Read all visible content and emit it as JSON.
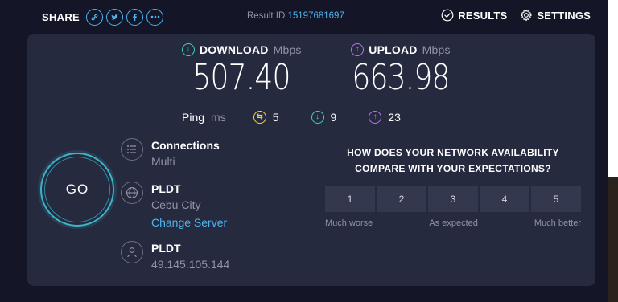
{
  "header": {
    "share_label": "SHARE",
    "share_icons": [
      "link-icon",
      "twitter-icon",
      "facebook-icon",
      "more-icon"
    ],
    "result_id_label": "Result ID",
    "result_id_value": "15197681697",
    "results_label": "RESULTS",
    "settings_label": "SETTINGS"
  },
  "download": {
    "label": "DOWNLOAD",
    "unit": "Mbps",
    "value": "507.40"
  },
  "upload": {
    "label": "UPLOAD",
    "unit": "Mbps",
    "value": "663.98"
  },
  "ping": {
    "label": "Ping",
    "unit": "ms",
    "idle": "5",
    "download": "9",
    "upload": "23"
  },
  "go_label": "GO",
  "connections": {
    "title": "Connections",
    "value": "Multi"
  },
  "server": {
    "name": "PLDT",
    "location": "Cebu City",
    "change_label": "Change Server"
  },
  "provider": {
    "name": "PLDT",
    "ip": "49.145.105.144"
  },
  "survey": {
    "question_line1": "HOW DOES YOUR NETWORK AVAILABILITY",
    "question_line2": "COMPARE WITH YOUR EXPECTATIONS?",
    "options": [
      "1",
      "2",
      "3",
      "4",
      "5"
    ],
    "label_low": "Much worse",
    "label_mid": "As expected",
    "label_high": "Much better"
  },
  "colors": {
    "background": "#141526",
    "panel": "#262a3f",
    "accent_blue": "#4fb3ef",
    "download": "#3bd2c3",
    "upload": "#b873f0",
    "ping": "#f5d43a"
  }
}
